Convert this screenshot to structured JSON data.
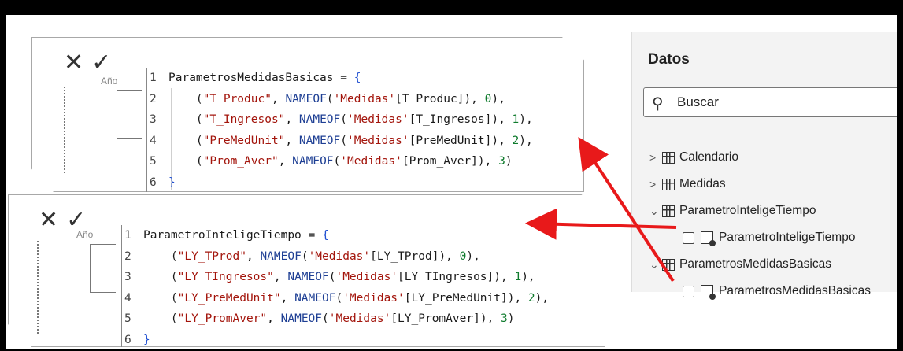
{
  "editor1": {
    "cancel_icon": "close-icon",
    "commit_icon": "check-icon",
    "behind_text": "Año",
    "lines": [
      {
        "n": "1",
        "parts": [
          [
            "id",
            "ParametrosMedidasBasicas = "
          ],
          [
            "br",
            "{"
          ]
        ]
      },
      {
        "n": "2",
        "parts": [
          [
            "id",
            "    ("
          ],
          [
            "str",
            "\"T_Produc\""
          ],
          [
            "id",
            ", "
          ],
          [
            "fn",
            "NAMEOF"
          ],
          [
            "id",
            "("
          ],
          [
            "str",
            "'Medidas'"
          ],
          [
            "id",
            "[T_Produc]), "
          ],
          [
            "num",
            "0"
          ],
          [
            "id",
            "),"
          ]
        ]
      },
      {
        "n": "3",
        "parts": [
          [
            "id",
            "    ("
          ],
          [
            "str",
            "\"T_Ingresos\""
          ],
          [
            "id",
            ", "
          ],
          [
            "fn",
            "NAMEOF"
          ],
          [
            "id",
            "("
          ],
          [
            "str",
            "'Medidas'"
          ],
          [
            "id",
            "[T_Ingresos]), "
          ],
          [
            "num",
            "1"
          ],
          [
            "id",
            "),"
          ]
        ]
      },
      {
        "n": "4",
        "parts": [
          [
            "id",
            "    ("
          ],
          [
            "str",
            "\"PreMedUnit\""
          ],
          [
            "id",
            ", "
          ],
          [
            "fn",
            "NAMEOF"
          ],
          [
            "id",
            "("
          ],
          [
            "str",
            "'Medidas'"
          ],
          [
            "id",
            "[PreMedUnit]), "
          ],
          [
            "num",
            "2"
          ],
          [
            "id",
            "),"
          ]
        ]
      },
      {
        "n": "5",
        "parts": [
          [
            "id",
            "    ("
          ],
          [
            "str",
            "\"Prom_Aver\""
          ],
          [
            "id",
            ", "
          ],
          [
            "fn",
            "NAMEOF"
          ],
          [
            "id",
            "("
          ],
          [
            "str",
            "'Medidas'"
          ],
          [
            "id",
            "[Prom_Aver]), "
          ],
          [
            "num",
            "3"
          ],
          [
            "id",
            ")"
          ]
        ]
      },
      {
        "n": "6",
        "parts": [
          [
            "br",
            "}"
          ]
        ]
      }
    ]
  },
  "editor2": {
    "cancel_icon": "close-icon",
    "commit_icon": "check-icon",
    "behind_text": "Año",
    "lines": [
      {
        "n": "1",
        "parts": [
          [
            "id",
            "ParametroInteligeTiempo = "
          ],
          [
            "br",
            "{"
          ]
        ]
      },
      {
        "n": "2",
        "parts": [
          [
            "id",
            "    ("
          ],
          [
            "str",
            "\"LY_TProd\""
          ],
          [
            "id",
            ", "
          ],
          [
            "fn",
            "NAMEOF"
          ],
          [
            "id",
            "("
          ],
          [
            "str",
            "'Medidas'"
          ],
          [
            "id",
            "[LY_TProd]), "
          ],
          [
            "num",
            "0"
          ],
          [
            "id",
            "),"
          ]
        ]
      },
      {
        "n": "3",
        "parts": [
          [
            "id",
            "    ("
          ],
          [
            "str",
            "\"LY_TIngresos\""
          ],
          [
            "id",
            ", "
          ],
          [
            "fn",
            "NAMEOF"
          ],
          [
            "id",
            "("
          ],
          [
            "str",
            "'Medidas'"
          ],
          [
            "id",
            "[LY_TIngresos]), "
          ],
          [
            "num",
            "1"
          ],
          [
            "id",
            "),"
          ]
        ]
      },
      {
        "n": "4",
        "parts": [
          [
            "id",
            "    ("
          ],
          [
            "str",
            "\"LY_PreMedUnit\""
          ],
          [
            "id",
            ", "
          ],
          [
            "fn",
            "NAMEOF"
          ],
          [
            "id",
            "("
          ],
          [
            "str",
            "'Medidas'"
          ],
          [
            "id",
            "[LY_PreMedUnit]), "
          ],
          [
            "num",
            "2"
          ],
          [
            "id",
            "),"
          ]
        ]
      },
      {
        "n": "5",
        "parts": [
          [
            "id",
            "    ("
          ],
          [
            "str",
            "\"LY_PromAver\""
          ],
          [
            "id",
            ", "
          ],
          [
            "fn",
            "NAMEOF"
          ],
          [
            "id",
            "("
          ],
          [
            "str",
            "'Medidas'"
          ],
          [
            "id",
            "[LY_PromAver]), "
          ],
          [
            "num",
            "3"
          ],
          [
            "id",
            ")"
          ]
        ]
      },
      {
        "n": "6",
        "parts": [
          [
            "br",
            "}"
          ]
        ]
      }
    ]
  },
  "data_pane": {
    "title": "Datos",
    "search_placeholder": "Buscar",
    "items": [
      {
        "label": "Calendario"
      },
      {
        "label": "Medidas"
      },
      {
        "label": "ParametroInteligeTiempo"
      },
      {
        "label": "ParametroInteligeTiempo"
      },
      {
        "label": "ParametrosMedidasBasicas"
      },
      {
        "label": "ParametrosMedidasBasicas"
      }
    ]
  },
  "colors": {
    "string": "#a3150c",
    "function": "#1e3f94",
    "number": "#0f7b2d",
    "arrow": "#e8191a"
  }
}
